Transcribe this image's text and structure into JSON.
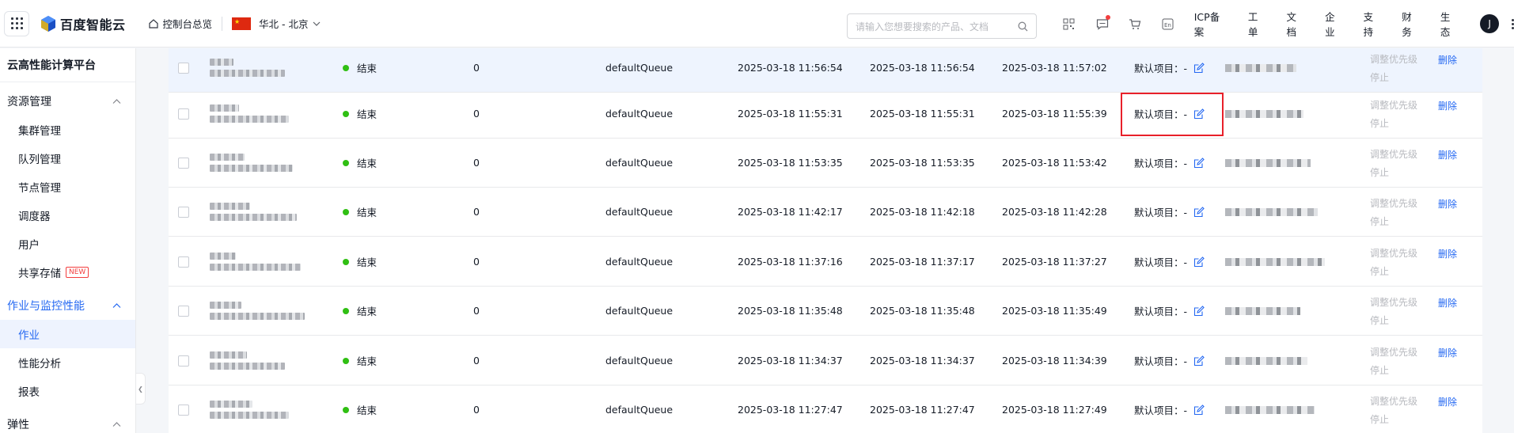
{
  "header": {
    "logo_text": "百度智能云",
    "console_link": "控制台总览",
    "region": "华北 - 北京",
    "search_placeholder": "请输入您想要搜索的产品、文档",
    "links": [
      "ICP备案",
      "工单",
      "文档",
      "企业",
      "支持",
      "财务",
      "生态"
    ],
    "avatar_initial": "J",
    "icons": [
      "qrcode-icon",
      "message-icon",
      "cart-icon",
      "language-icon"
    ]
  },
  "sidebar": {
    "title": "云高性能计算平台",
    "groups": [
      {
        "label": "资源管理",
        "items": [
          "集群管理",
          "队列管理",
          "节点管理",
          "调度器",
          "用户",
          "共享存储"
        ]
      },
      {
        "label": "作业与监控性能",
        "items": [
          "作业",
          "性能分析",
          "报表"
        ]
      },
      {
        "label": "弹性",
        "items": []
      }
    ],
    "new_badge": "NEW",
    "active_item": "作业"
  },
  "table": {
    "rows": [
      {
        "status": "结束",
        "priority": "0",
        "queue": "defaultQueue",
        "submit_time": "2025-03-18 11:56:54",
        "start_time": "2025-03-18 11:56:54",
        "end_time": "2025-03-18 11:57:02",
        "project": "默认项目：-",
        "op_adjust": "调整优先级",
        "op_stop": "停止",
        "op_delete": "删除"
      },
      {
        "status": "结束",
        "priority": "0",
        "queue": "defaultQueue",
        "submit_time": "2025-03-18 11:55:31",
        "start_time": "2025-03-18 11:55:31",
        "end_time": "2025-03-18 11:55:39",
        "project": "默认项目：-",
        "op_adjust": "调整优先级",
        "op_stop": "停止",
        "op_delete": "删除"
      },
      {
        "status": "结束",
        "priority": "0",
        "queue": "defaultQueue",
        "submit_time": "2025-03-18 11:53:35",
        "start_time": "2025-03-18 11:53:35",
        "end_time": "2025-03-18 11:53:42",
        "project": "默认项目：-",
        "op_adjust": "调整优先级",
        "op_stop": "停止",
        "op_delete": "删除"
      },
      {
        "status": "结束",
        "priority": "0",
        "queue": "defaultQueue",
        "submit_time": "2025-03-18 11:42:17",
        "start_time": "2025-03-18 11:42:18",
        "end_time": "2025-03-18 11:42:28",
        "project": "默认项目：-",
        "op_adjust": "调整优先级",
        "op_stop": "停止",
        "op_delete": "删除"
      },
      {
        "status": "结束",
        "priority": "0",
        "queue": "defaultQueue",
        "submit_time": "2025-03-18 11:37:16",
        "start_time": "2025-03-18 11:37:17",
        "end_time": "2025-03-18 11:37:27",
        "project": "默认项目：-",
        "op_adjust": "调整优先级",
        "op_stop": "停止",
        "op_delete": "删除"
      },
      {
        "status": "结束",
        "priority": "0",
        "queue": "defaultQueue",
        "submit_time": "2025-03-18 11:35:48",
        "start_time": "2025-03-18 11:35:48",
        "end_time": "2025-03-18 11:35:49",
        "project": "默认项目：-",
        "op_adjust": "调整优先级",
        "op_stop": "停止",
        "op_delete": "删除"
      },
      {
        "status": "结束",
        "priority": "0",
        "queue": "defaultQueue",
        "submit_time": "2025-03-18 11:34:37",
        "start_time": "2025-03-18 11:34:37",
        "end_time": "2025-03-18 11:34:39",
        "project": "默认项目：-",
        "op_adjust": "调整优先级",
        "op_stop": "停止",
        "op_delete": "删除"
      },
      {
        "status": "结束",
        "priority": "0",
        "queue": "defaultQueue",
        "submit_time": "2025-03-18 11:27:47",
        "start_time": "2025-03-18 11:27:47",
        "end_time": "2025-03-18 11:27:49",
        "project": "默认项目：-",
        "op_adjust": "调整优先级",
        "op_stop": "停止",
        "op_delete": "删除"
      }
    ],
    "highlighted_row": 0,
    "status_color": "#30bf13",
    "link_color": "#2468f2"
  }
}
